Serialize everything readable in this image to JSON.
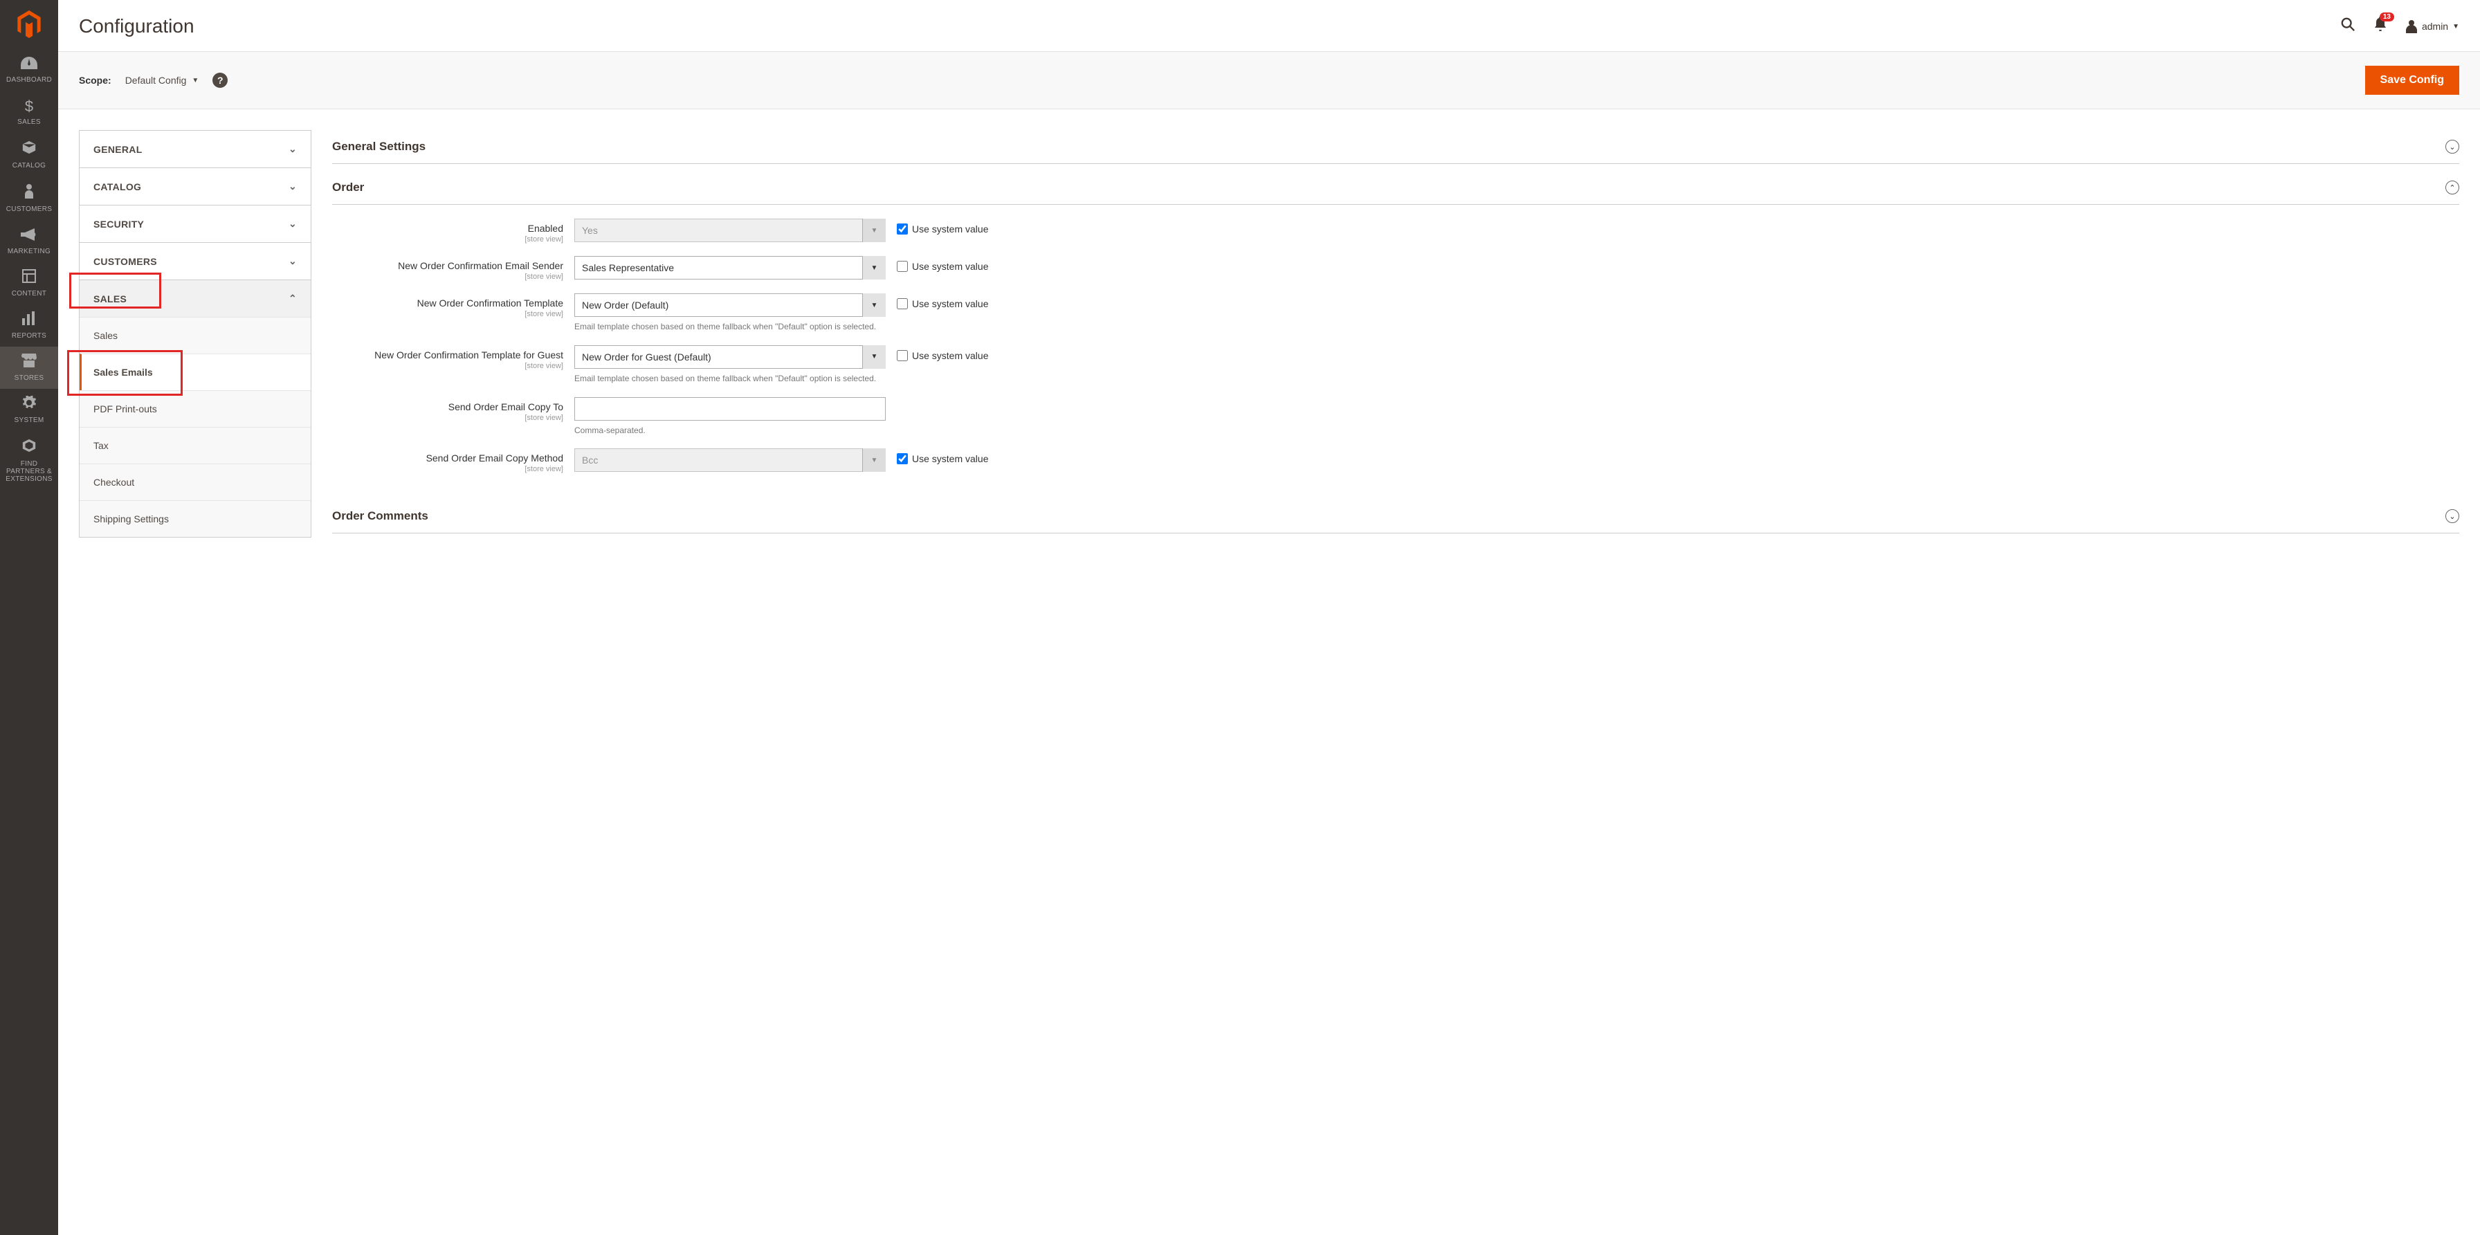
{
  "page": {
    "title": "Configuration"
  },
  "header": {
    "notif_count": "13",
    "user": "admin"
  },
  "scope": {
    "label": "Scope:",
    "value": "Default Config",
    "save_btn": "Save Config"
  },
  "sidebar": [
    {
      "label": "DASHBOARD"
    },
    {
      "label": "SALES"
    },
    {
      "label": "CATALOG"
    },
    {
      "label": "CUSTOMERS"
    },
    {
      "label": "MARKETING"
    },
    {
      "label": "CONTENT"
    },
    {
      "label": "REPORTS"
    },
    {
      "label": "STORES"
    },
    {
      "label": "SYSTEM"
    },
    {
      "label": "FIND PARTNERS & EXTENSIONS"
    }
  ],
  "tabs": {
    "general": "GENERAL",
    "catalog": "CATALOG",
    "security": "SECURITY",
    "customers": "CUSTOMERS",
    "sales": "SALES",
    "sales_sub": {
      "sales": "Sales",
      "sales_emails": "Sales Emails",
      "pdf": "PDF Print-outs",
      "tax": "Tax",
      "checkout": "Checkout",
      "shipping": "Shipping Settings"
    }
  },
  "sections": {
    "general_settings": "General Settings",
    "order": "Order",
    "order_comments": "Order Comments"
  },
  "fields": {
    "enabled": {
      "label": "Enabled",
      "scope": "[store view]",
      "value": "Yes"
    },
    "sender": {
      "label": "New Order Confirmation Email Sender",
      "scope": "[store view]",
      "value": "Sales Representative"
    },
    "template": {
      "label": "New Order Confirmation Template",
      "scope": "[store view]",
      "value": "New Order (Default)",
      "note": "Email template chosen based on theme fallback when \"Default\" option is selected."
    },
    "template_guest": {
      "label": "New Order Confirmation Template for Guest",
      "scope": "[store view]",
      "value": "New Order for Guest (Default)",
      "note": "Email template chosen based on theme fallback when \"Default\" option is selected."
    },
    "copy_to": {
      "label": "Send Order Email Copy To",
      "scope": "[store view]",
      "value": "",
      "note": "Comma-separated."
    },
    "copy_method": {
      "label": "Send Order Email Copy Method",
      "scope": "[store view]",
      "value": "Bcc"
    },
    "use_system": "Use system value"
  }
}
